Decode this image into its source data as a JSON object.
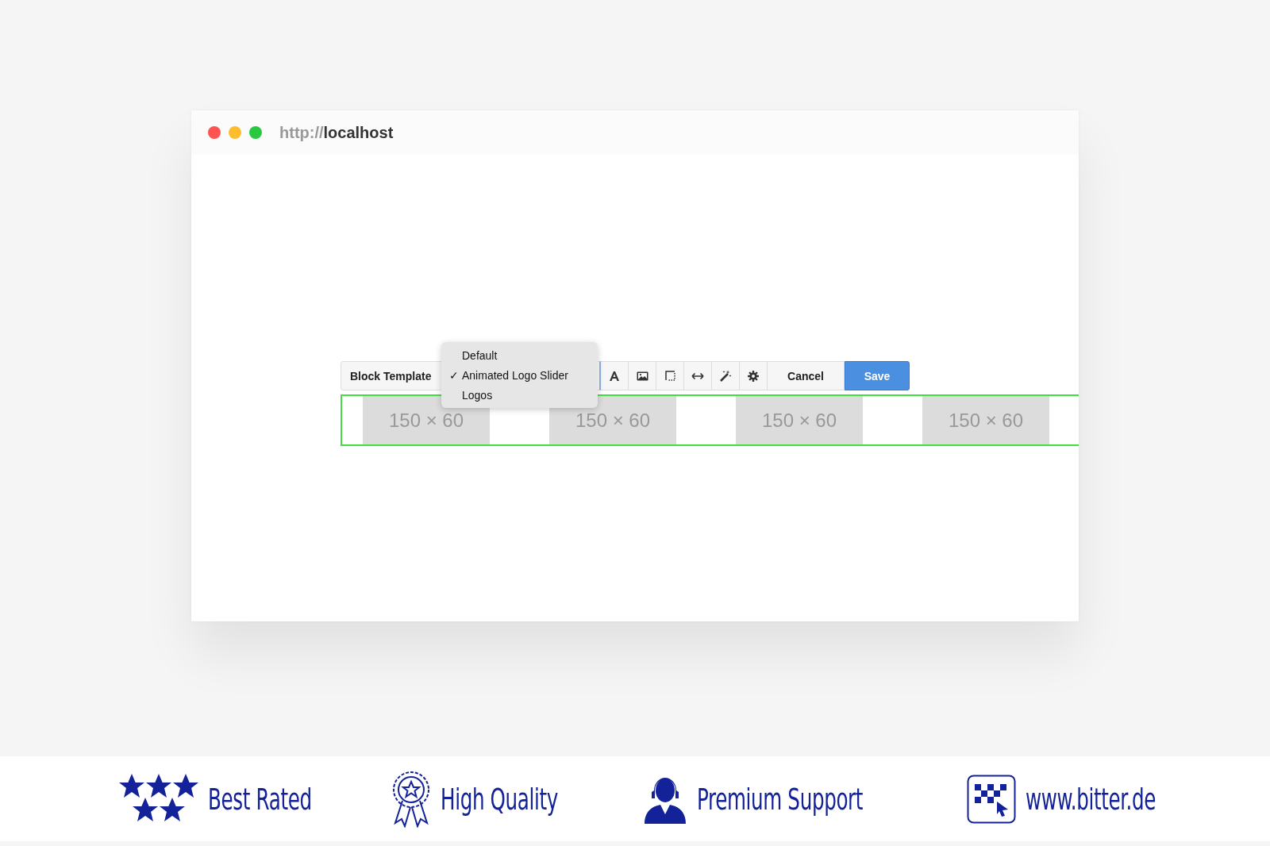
{
  "window": {
    "url": {
      "scheme": "http://",
      "host": "localhost"
    }
  },
  "toolbar": {
    "template_button": "Block Template",
    "tools": [
      {
        "kind": "text"
      },
      {
        "kind": "image"
      },
      {
        "kind": "border"
      },
      {
        "kind": "width"
      },
      {
        "kind": "magic"
      },
      {
        "kind": "settings"
      }
    ],
    "cancel": "Cancel",
    "save": "Save"
  },
  "template_menu": [
    {
      "label": "Default",
      "selected": false
    },
    {
      "label": "Animated Logo Slider",
      "selected": true
    },
    {
      "label": "Logos",
      "selected": false
    }
  ],
  "checkmark": "✓",
  "logo_slider": {
    "selected": true,
    "logos": [
      "150 × 60",
      "150 × 60",
      "150 × 60",
      "150 × 60"
    ]
  },
  "features": [
    {
      "kind": "stars",
      "label": "Best Rated"
    },
    {
      "kind": "award",
      "label": "High Quality"
    },
    {
      "kind": "support",
      "label": "Premium Support"
    },
    {
      "kind": "site",
      "label": "www.bitter.de"
    }
  ]
}
